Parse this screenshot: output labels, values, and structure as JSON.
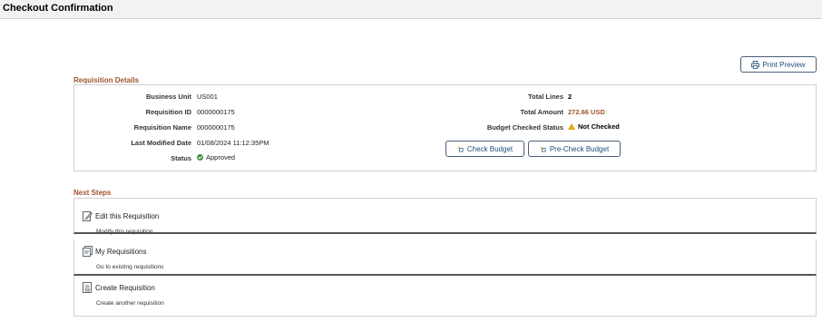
{
  "page": {
    "title": "Checkout Confirmation"
  },
  "toolbar": {
    "print_preview_label": "Print Preview"
  },
  "requisition_details": {
    "section_title": "Requisition Details",
    "left_fields": [
      {
        "label": "Business Unit",
        "value": "US001"
      },
      {
        "label": "Requisition ID",
        "value": "0000000175"
      },
      {
        "label": "Requisition Name",
        "value": "0000000175"
      },
      {
        "label": "Last Modified Date",
        "value": "01/08/2024 11:12:35PM"
      },
      {
        "label": "Status",
        "value": "Approved"
      }
    ],
    "right_fields": [
      {
        "label": "Total Lines",
        "value": "2"
      },
      {
        "label": "Total Amount",
        "value": "272.66 USD"
      },
      {
        "label": "Budget Checked Status",
        "value": "Not Checked"
      }
    ],
    "check_budget_label": "Check Budget",
    "pre_check_budget_label": "Pre-Check Budget"
  },
  "next_steps": {
    "section_title": "Next Steps",
    "items": [
      {
        "title": "Edit this Requisition",
        "description": "Modify this requisition",
        "icon": "edit-document-icon"
      },
      {
        "title": "My Requisitions",
        "description": "Go to existing requisitions",
        "icon": "requisitions-list-icon"
      },
      {
        "title": "Create Requisition",
        "description": "Create another requisition",
        "icon": "create-requisition-icon"
      }
    ]
  },
  "colors": {
    "accent_section": "#a0522d",
    "link": "#1f4e79",
    "approved": "#3a8f3a",
    "warning": "#e8a317"
  }
}
